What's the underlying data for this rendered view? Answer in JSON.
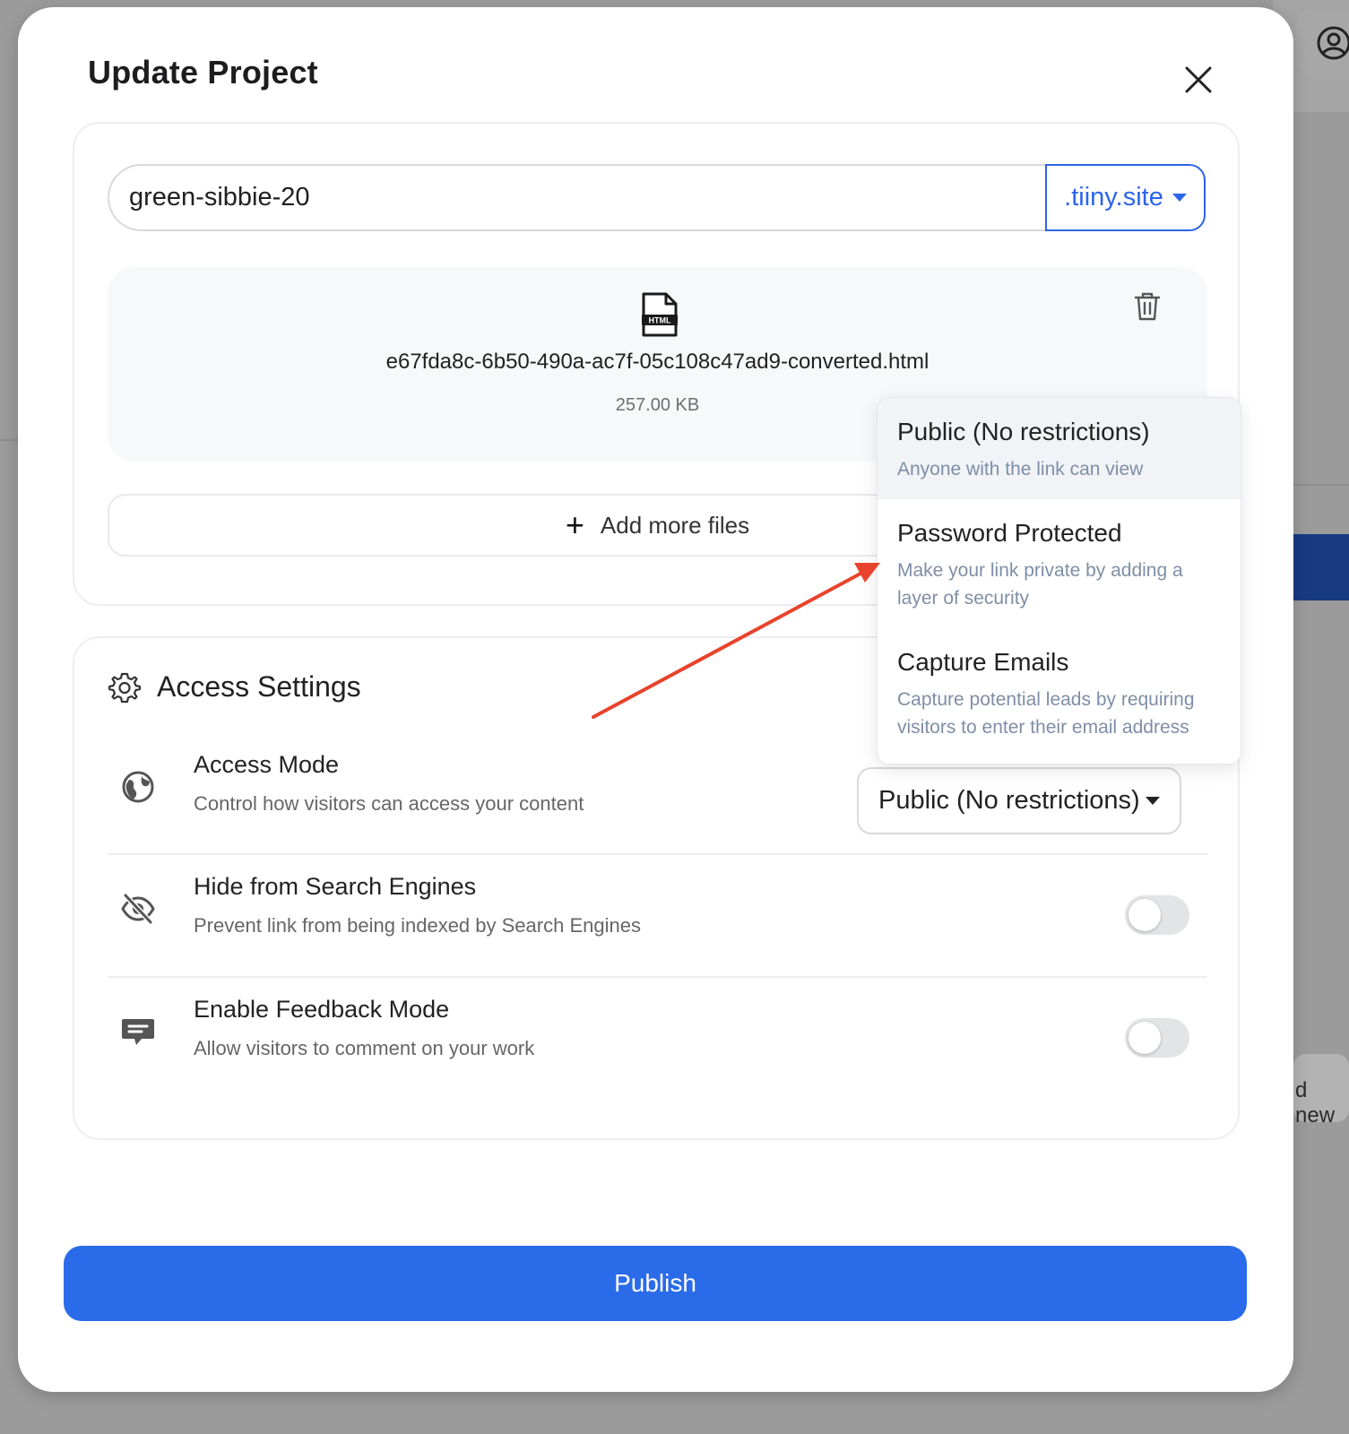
{
  "modal": {
    "title": "Update Project"
  },
  "project": {
    "name": "green-sibbie-20",
    "domain": ".tiiny.site"
  },
  "file": {
    "icon_label": "HTML",
    "name": "e67fda8c-6b50-490a-ac7f-05c108c47ad9-converted.html",
    "size": "257.00 KB"
  },
  "add_files_label": "Add more files",
  "access": {
    "heading": "Access Settings",
    "rows": [
      {
        "title": "Access Mode",
        "desc": "Control how visitors can access your content",
        "icon": "globe-icon",
        "control": "select",
        "value": "Public (No restrictions)"
      },
      {
        "title": "Hide from Search Engines",
        "desc": "Prevent link from being indexed by Search Engines",
        "icon": "eye-off-icon",
        "control": "toggle",
        "value": false
      },
      {
        "title": "Enable Feedback Mode",
        "desc": "Allow visitors to comment on your work",
        "icon": "comment-icon",
        "control": "toggle",
        "value": false
      }
    ]
  },
  "dropdown": {
    "options": [
      {
        "title": "Public (No restrictions)",
        "desc": "Anyone with the link can view",
        "highlighted": true
      },
      {
        "title": "Password Protected",
        "desc": "Make your link private by adding a layer of security",
        "highlighted": false
      },
      {
        "title": "Capture Emails",
        "desc": "Capture potential leads by requiring visitors to enter their email address",
        "highlighted": false
      }
    ]
  },
  "publish_label": "Publish",
  "background": {
    "fragment_new": "d new"
  },
  "colors": {
    "accent": "#2a6be9",
    "annotation_arrow": "#e8432c"
  }
}
